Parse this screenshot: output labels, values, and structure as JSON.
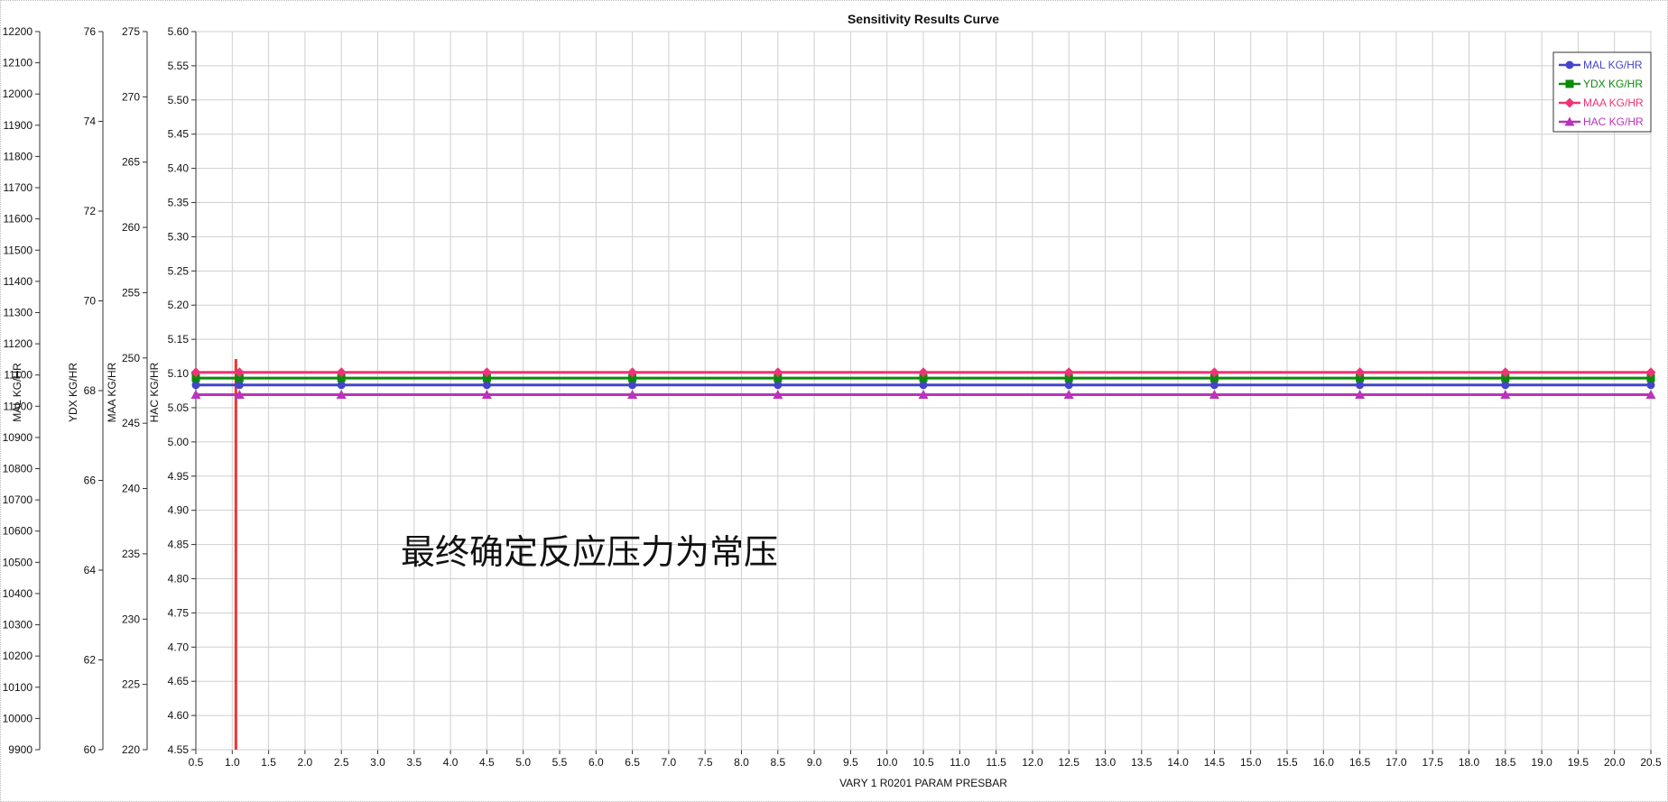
{
  "chart_data": {
    "type": "line",
    "title": "Sensitivity Results Curve",
    "xlabel": "VARY   1 R0201 PARAM PRESBAR",
    "xlim": [
      0.5,
      20.5
    ],
    "x_ticks": [
      "0.5",
      "1.0",
      "1.5",
      "2.0",
      "2.5",
      "3.0",
      "3.5",
      "4.0",
      "4.5",
      "5.0",
      "5.5",
      "6.0",
      "6.5",
      "7.0",
      "7.5",
      "8.0",
      "8.5",
      "9.0",
      "9.5",
      "10.0",
      "10.5",
      "11.0",
      "11.5",
      "12.0",
      "12.5",
      "13.0",
      "13.5",
      "14.0",
      "14.5",
      "15.0",
      "15.5",
      "16.0",
      "16.5",
      "17.0",
      "17.5",
      "18.0",
      "18.5",
      "19.0",
      "19.5",
      "20.0",
      "20.5"
    ],
    "y_axes": [
      {
        "id": "mal",
        "label": "MAL KG/HR",
        "ylim": [
          9900,
          12200
        ],
        "ticks": [
          "9900",
          "10000",
          "10100",
          "10200",
          "10300",
          "10400",
          "10500",
          "10600",
          "10700",
          "10800",
          "10900",
          "11000",
          "11100",
          "11200",
          "11300",
          "11400",
          "11500",
          "11600",
          "11700",
          "11800",
          "11900",
          "12000",
          "12100",
          "12200"
        ]
      },
      {
        "id": "ydx",
        "label": "YDX KG/HR",
        "ylim": [
          60,
          76
        ],
        "ticks": [
          "60",
          "62",
          "64",
          "66",
          "68",
          "70",
          "72",
          "74",
          "76"
        ]
      },
      {
        "id": "maa",
        "label": "MAA KG/HR",
        "ylim": [
          220,
          275
        ],
        "ticks": [
          "220",
          "225",
          "230",
          "235",
          "240",
          "245",
          "250",
          "255",
          "260",
          "265",
          "270",
          "275"
        ]
      },
      {
        "id": "hac",
        "label": "HAC KG/HR",
        "ylim": [
          4.55,
          5.6
        ],
        "ticks": [
          "4.55",
          "4.60",
          "4.65",
          "4.70",
          "4.75",
          "4.80",
          "4.85",
          "4.90",
          "4.95",
          "5.00",
          "5.05",
          "5.10",
          "5.15",
          "5.20",
          "5.25",
          "5.30",
          "5.35",
          "5.40",
          "5.45",
          "5.50",
          "5.55",
          "5.60"
        ]
      }
    ],
    "series": [
      {
        "name": "MAL KG/HR",
        "axis": "mal",
        "color": "#4444cc",
        "marker": "circle",
        "x": [
          0.5,
          1.1,
          2.5,
          4.5,
          6.5,
          8.5,
          10.5,
          12.5,
          14.5,
          16.5,
          18.5,
          20.5
        ],
        "y": [
          11068,
          11068,
          11068,
          11068,
          11068,
          11068,
          11068,
          11068,
          11068,
          11068,
          11068,
          11068
        ]
      },
      {
        "name": "YDX KG/HR",
        "axis": "ydx",
        "color": "#0a8a0a",
        "marker": "square",
        "x": [
          0.5,
          1.1,
          2.5,
          4.5,
          6.5,
          8.5,
          10.5,
          12.5,
          14.5,
          16.5,
          18.5,
          20.5
        ],
        "y": [
          68.28,
          68.28,
          68.28,
          68.28,
          68.28,
          68.28,
          68.28,
          68.28,
          68.28,
          68.28,
          68.28,
          68.28
        ]
      },
      {
        "name": "MAA KG/HR",
        "axis": "maa",
        "color": "#ee3377",
        "marker": "diamond",
        "x": [
          0.5,
          1.1,
          2.5,
          4.5,
          6.5,
          8.5,
          10.5,
          12.5,
          14.5,
          16.5,
          18.5,
          20.5
        ],
        "y": [
          248.9,
          248.9,
          248.9,
          248.9,
          248.9,
          248.9,
          248.9,
          248.9,
          248.9,
          248.9,
          248.9,
          248.9
        ]
      },
      {
        "name": "HAC KG/HR",
        "axis": "hac",
        "color": "#bb33bb",
        "marker": "triangle",
        "x": [
          0.5,
          1.1,
          2.5,
          4.5,
          6.5,
          8.5,
          10.5,
          12.5,
          14.5,
          16.5,
          18.5,
          20.5
        ],
        "y": [
          5.069,
          5.069,
          5.069,
          5.069,
          5.069,
          5.069,
          5.069,
          5.069,
          5.069,
          5.069,
          5.069,
          5.069
        ]
      }
    ],
    "vertical_marker": {
      "x": 1.05,
      "color": "#ee3333"
    },
    "annotation": "最终确定反应压力为常压",
    "grid": true,
    "legend_position": "top-right"
  }
}
